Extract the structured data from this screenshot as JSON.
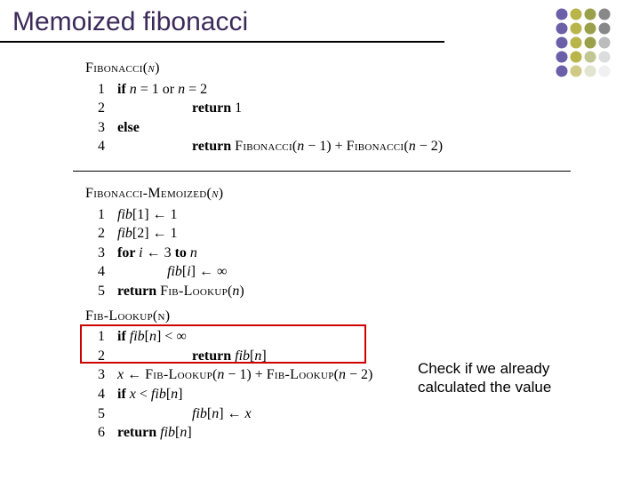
{
  "title": "Memoized fibonacci",
  "algo1": {
    "name": "Fibonacci",
    "arg": "n",
    "lines": [
      {
        "n": "1",
        "indent": 0,
        "frags": [
          {
            "t": "if ",
            "c": "kw"
          },
          {
            "t": "n",
            "c": "it"
          },
          {
            "t": " = 1 or ",
            "c": ""
          },
          {
            "t": "n",
            "c": "it"
          },
          {
            "t": " = 2",
            "c": ""
          }
        ]
      },
      {
        "n": "2",
        "indent": 3,
        "frags": [
          {
            "t": "return ",
            "c": "kw"
          },
          {
            "t": "1",
            "c": ""
          }
        ]
      },
      {
        "n": "3",
        "indent": 0,
        "frags": [
          {
            "t": "else",
            "c": "kw"
          }
        ]
      },
      {
        "n": "4",
        "indent": 3,
        "frags": [
          {
            "t": "return ",
            "c": "kw"
          },
          {
            "t": "Fibonacci",
            "c": "sc"
          },
          {
            "t": "(",
            "c": ""
          },
          {
            "t": "n",
            "c": "it"
          },
          {
            "t": " − 1) + ",
            "c": ""
          },
          {
            "t": "Fibonacci",
            "c": "sc"
          },
          {
            "t": "(",
            "c": ""
          },
          {
            "t": "n",
            "c": "it"
          },
          {
            "t": " − 2)",
            "c": ""
          }
        ]
      }
    ]
  },
  "algo2": {
    "name": "Fibonacci-Memoized",
    "arg": "n",
    "lines": [
      {
        "n": "1",
        "indent": 0,
        "frags": [
          {
            "t": "fib",
            "c": "it"
          },
          {
            "t": "[1] ← 1",
            "c": ""
          }
        ]
      },
      {
        "n": "2",
        "indent": 0,
        "frags": [
          {
            "t": "fib",
            "c": "it"
          },
          {
            "t": "[2] ← 1",
            "c": ""
          }
        ]
      },
      {
        "n": "3",
        "indent": 0,
        "frags": [
          {
            "t": "for ",
            "c": "kw"
          },
          {
            "t": "i",
            "c": "it"
          },
          {
            "t": " ← 3 ",
            "c": ""
          },
          {
            "t": "to ",
            "c": "kw"
          },
          {
            "t": "n",
            "c": "it"
          }
        ]
      },
      {
        "n": "4",
        "indent": 2,
        "frags": [
          {
            "t": "fib",
            "c": "it"
          },
          {
            "t": "[",
            "c": ""
          },
          {
            "t": "i",
            "c": "it"
          },
          {
            "t": "] ← ∞",
            "c": ""
          }
        ]
      },
      {
        "n": "5",
        "indent": 0,
        "frags": [
          {
            "t": "return ",
            "c": "kw"
          },
          {
            "t": "Fib-Lookup",
            "c": "sc"
          },
          {
            "t": "(",
            "c": ""
          },
          {
            "t": "n",
            "c": "it"
          },
          {
            "t": ")",
            "c": ""
          }
        ]
      }
    ]
  },
  "algo3": {
    "name": "Fib-Lookup",
    "arg": "n",
    "lines": [
      {
        "n": "1",
        "indent": 0,
        "frags": [
          {
            "t": "if ",
            "c": "kw"
          },
          {
            "t": "fib",
            "c": "it"
          },
          {
            "t": "[",
            "c": ""
          },
          {
            "t": "n",
            "c": "it"
          },
          {
            "t": "] < ∞",
            "c": ""
          }
        ]
      },
      {
        "n": "2",
        "indent": 3,
        "frags": [
          {
            "t": "return ",
            "c": "kw"
          },
          {
            "t": "fib",
            "c": "it"
          },
          {
            "t": "[",
            "c": ""
          },
          {
            "t": "n",
            "c": "it"
          },
          {
            "t": "]",
            "c": ""
          }
        ]
      },
      {
        "n": "3",
        "indent": 0,
        "frags": [
          {
            "t": "x",
            "c": "it"
          },
          {
            "t": " ← ",
            "c": ""
          },
          {
            "t": "Fib-Lookup",
            "c": "sc"
          },
          {
            "t": "(",
            "c": ""
          },
          {
            "t": "n",
            "c": "it"
          },
          {
            "t": " − 1) + ",
            "c": ""
          },
          {
            "t": "Fib-Lookup",
            "c": "sc"
          },
          {
            "t": "(",
            "c": ""
          },
          {
            "t": "n",
            "c": "it"
          },
          {
            "t": " − 2)",
            "c": ""
          }
        ]
      },
      {
        "n": "4",
        "indent": 0,
        "frags": [
          {
            "t": "if ",
            "c": "kw"
          },
          {
            "t": "x",
            "c": "it"
          },
          {
            "t": " < ",
            "c": ""
          },
          {
            "t": "fib",
            "c": "it"
          },
          {
            "t": "[",
            "c": ""
          },
          {
            "t": "n",
            "c": "it"
          },
          {
            "t": "]",
            "c": ""
          }
        ]
      },
      {
        "n": "5",
        "indent": 3,
        "frags": [
          {
            "t": "fib",
            "c": "it"
          },
          {
            "t": "[",
            "c": ""
          },
          {
            "t": "n",
            "c": "it"
          },
          {
            "t": "] ← ",
            "c": ""
          },
          {
            "t": "x",
            "c": "it"
          }
        ]
      },
      {
        "n": "6",
        "indent": 0,
        "frags": [
          {
            "t": "return ",
            "c": "kw"
          },
          {
            "t": "fib",
            "c": "it"
          },
          {
            "t": "[",
            "c": ""
          },
          {
            "t": "n",
            "c": "it"
          },
          {
            "t": "]",
            "c": ""
          }
        ]
      }
    ]
  },
  "annotation": "Check if we already calculated the value",
  "logo": {
    "cols": [
      [
        "#6b5fa8",
        "#6b5fa8",
        "#6b5fa8",
        "#6b5fa8",
        "#6b5fa8"
      ],
      [
        "#b9b54b",
        "#b9b54b",
        "#b9b54b",
        "#b9b54b",
        "#cfcb86"
      ],
      [
        "#9aa04a",
        "#9aa04a",
        "#9aa04a",
        "#c2c692",
        "#e1e4cf"
      ],
      [
        "#888888",
        "#888888",
        "#bcbcbc",
        "#dcdcdc",
        "#f0f0f0"
      ]
    ]
  }
}
